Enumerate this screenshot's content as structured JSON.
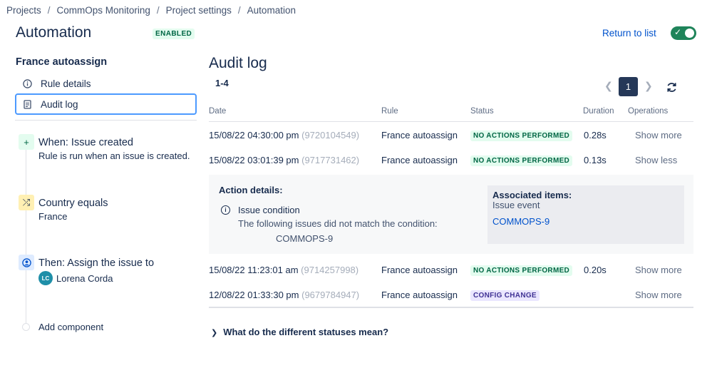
{
  "breadcrumb": [
    "Projects",
    "CommOps Monitoring",
    "Project settings",
    "Automation"
  ],
  "header": {
    "title": "Automation",
    "status_badge": "ENABLED",
    "return_link": "Return to list",
    "toggle_on": true
  },
  "sidebar": {
    "rule_name": "France autoassign",
    "items": [
      {
        "label": "Rule details",
        "icon": "info-icon"
      },
      {
        "label": "Audit log",
        "icon": "document-icon",
        "active": true
      }
    ],
    "components": [
      {
        "title": "When: Issue created",
        "subtitle": "Rule is run when an issue is created.",
        "icon": "plus-icon"
      },
      {
        "title": "Country equals",
        "subtitle": "France",
        "icon": "shuffle-icon"
      },
      {
        "title": "Then: Assign the issue to",
        "avatar_initials": "LC",
        "assignee": "Lorena Corda",
        "icon": "person-icon"
      }
    ],
    "add_component": "Add component"
  },
  "main": {
    "title": "Audit log",
    "range": "1-4",
    "current_page": "1",
    "columns": [
      "Date",
      "Rule",
      "Status",
      "Duration",
      "Operations"
    ],
    "rows": [
      {
        "date": "15/08/22 04:30:00 pm",
        "id": "(9720104549)",
        "rule": "France autoassign",
        "status": "NO ACTIONS PERFORMED",
        "duration": "0.28s",
        "op": "Show more"
      },
      {
        "date": "15/08/22 03:01:39 pm",
        "id": "(9717731462)",
        "rule": "France autoassign",
        "status": "NO ACTIONS PERFORMED",
        "duration": "0.13s",
        "op": "Show less"
      },
      {
        "date": "15/08/22 11:23:01 am",
        "id": "(9714257998)",
        "rule": "France autoassign",
        "status": "NO ACTIONS PERFORMED",
        "duration": "0.20s",
        "op": "Show more"
      },
      {
        "date": "12/08/22 01:33:30 pm",
        "id": "(9679784947)",
        "rule": "France autoassign",
        "status": "CONFIG CHANGE",
        "duration": "",
        "op": "Show more"
      }
    ],
    "details": {
      "title": "Action details:",
      "condition_title": "Issue condition",
      "condition_desc": "The following issues did not match the condition:",
      "condition_issue": "COMMOPS-9",
      "assoc_title": "Associated items:",
      "assoc_event": "Issue event",
      "assoc_link": "COMMOPS-9"
    },
    "faq": "What do the different statuses mean?"
  },
  "colors": {
    "accent": "#0052cc",
    "toggle": "#1f845a",
    "green_lozenge_bg": "#e3fcef",
    "purple_lozenge_bg": "#eae6ff"
  }
}
